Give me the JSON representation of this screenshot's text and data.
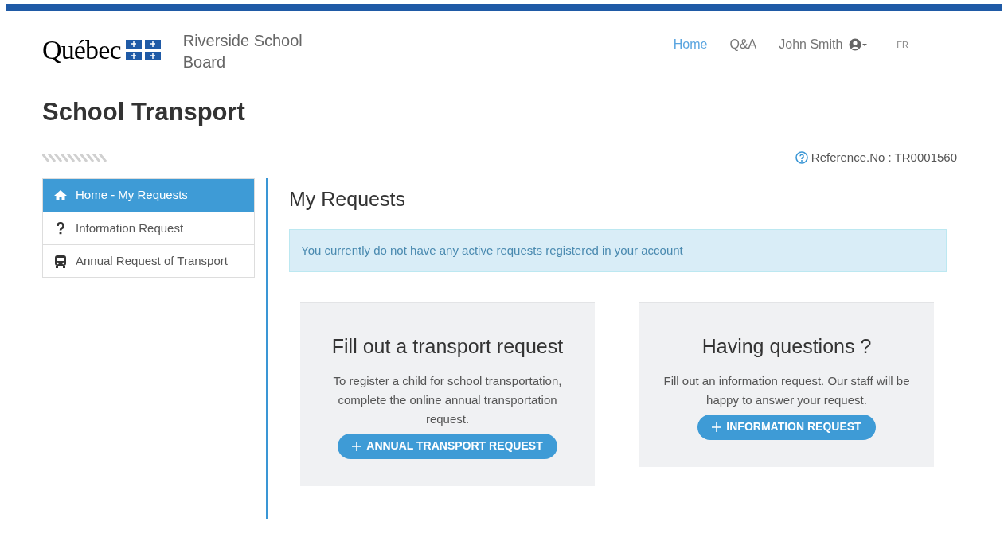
{
  "logo": {
    "wordmark": "Québec",
    "organization": "Riverside School Board"
  },
  "nav": [
    {
      "label": "Home",
      "selected": true,
      "kind": "link"
    },
    {
      "label": "Q&A",
      "selected": false,
      "kind": "link"
    },
    {
      "label": "John Smith",
      "selected": false,
      "kind": "user"
    },
    {
      "label": "FR",
      "selected": false,
      "kind": "lang"
    }
  ],
  "page_title": "School Transport",
  "reference": "Reference.No : TR0001560",
  "sidebar": {
    "items": [
      {
        "label": "Home - My Requests",
        "kind": "home",
        "selected": true
      },
      {
        "label": "Information Request",
        "kind": "question",
        "selected": false
      },
      {
        "label": "Annual Request of Transport",
        "kind": "bus",
        "selected": false
      }
    ]
  },
  "main": {
    "heading": "My Requests",
    "alert": "You currently do not have any active requests registered in your account",
    "cards": [
      {
        "title": "Fill out a transport request",
        "text": "To register a child for school transportation, complete the online annual transportation request.",
        "button": "ANNUAL TRANSPORT REQUEST"
      },
      {
        "title": "Having questions ?",
        "text": "Fill out an information request. Our staff will be happy to answer your request.",
        "button": "INFORMATION REQUEST"
      }
    ]
  }
}
